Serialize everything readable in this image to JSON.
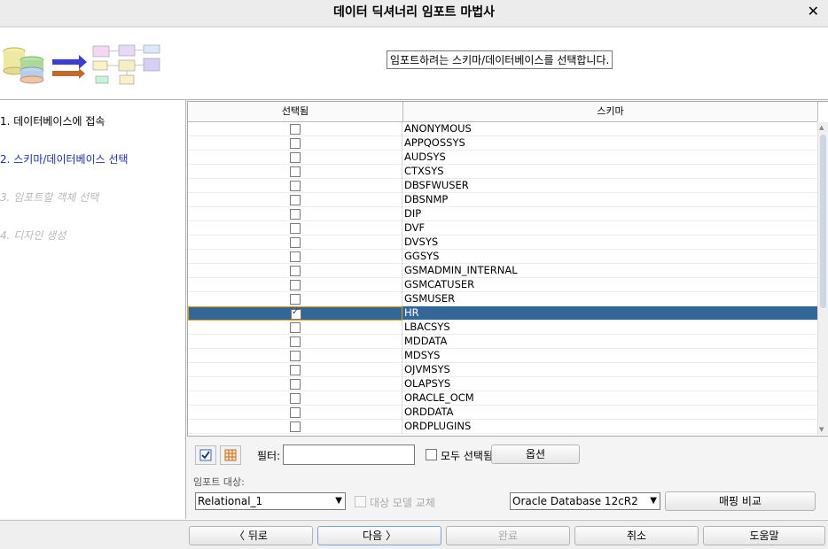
{
  "window": {
    "title": "데이터 딕셔너리 임포트 마법사",
    "close_glyph": "✕"
  },
  "header": {
    "instruction": "임포트하려는 스키마/데이터베이스를 선택합니다."
  },
  "steps": [
    {
      "label": "1. 데이터베이스에 접속",
      "state": "done"
    },
    {
      "label": "2. 스키마/데이터베이스 선택",
      "state": "current"
    },
    {
      "label": "3. 임포트할 객체 선택",
      "state": "future"
    },
    {
      "label": "4. 디자인 생성",
      "state": "future"
    }
  ],
  "table": {
    "columns": [
      "선택됨",
      "스키마"
    ],
    "rows": [
      {
        "name": "ANONYMOUS",
        "checked": false,
        "selected": false
      },
      {
        "name": "APPQOSSYS",
        "checked": false,
        "selected": false
      },
      {
        "name": "AUDSYS",
        "checked": false,
        "selected": false
      },
      {
        "name": "CTXSYS",
        "checked": false,
        "selected": false
      },
      {
        "name": "DBSFWUSER",
        "checked": false,
        "selected": false
      },
      {
        "name": "DBSNMP",
        "checked": false,
        "selected": false
      },
      {
        "name": "DIP",
        "checked": false,
        "selected": false
      },
      {
        "name": "DVF",
        "checked": false,
        "selected": false
      },
      {
        "name": "DVSYS",
        "checked": false,
        "selected": false
      },
      {
        "name": "GGSYS",
        "checked": false,
        "selected": false
      },
      {
        "name": "GSMADMIN_INTERNAL",
        "checked": false,
        "selected": false
      },
      {
        "name": "GSMCATUSER",
        "checked": false,
        "selected": false
      },
      {
        "name": "GSMUSER",
        "checked": false,
        "selected": false
      },
      {
        "name": "HR",
        "checked": true,
        "selected": true
      },
      {
        "name": "LBACSYS",
        "checked": false,
        "selected": false
      },
      {
        "name": "MDDATA",
        "checked": false,
        "selected": false
      },
      {
        "name": "MDSYS",
        "checked": false,
        "selected": false
      },
      {
        "name": "OJVMSYS",
        "checked": false,
        "selected": false
      },
      {
        "name": "OLAPSYS",
        "checked": false,
        "selected": false
      },
      {
        "name": "ORACLE_OCM",
        "checked": false,
        "selected": false
      },
      {
        "name": "ORDDATA",
        "checked": false,
        "selected": false
      },
      {
        "name": "ORDPLUGINS",
        "checked": false,
        "selected": false
      }
    ]
  },
  "controls": {
    "filter_label": "필터:",
    "filter_value": "",
    "select_all_label": "모두 선택됨",
    "options_button": "옵션",
    "import_target_label": "임포트 대상:",
    "target_model": "Relational_1",
    "replace_label": "대상 모델 교체",
    "db_version": "Oracle Database 12cR2",
    "compare_button": "매핑 비교"
  },
  "footer": {
    "back": "〈 뒤로",
    "next": "다음 〉",
    "finish": "완료",
    "cancel": "취소",
    "help": "도움말"
  },
  "colors": {
    "selected_row": "#336699",
    "current_step": "#1c2fb7",
    "disabled_text": "#a9a9a9"
  }
}
